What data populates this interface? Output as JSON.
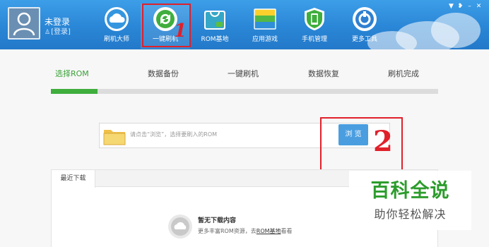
{
  "header": {
    "user": {
      "status": "未登录",
      "login_link": "[登录]"
    },
    "nav_tabs": [
      {
        "label": "刷机大师",
        "icon": "cloud-icon"
      },
      {
        "label": "一键刷机",
        "icon": "refresh-icon",
        "active": true
      },
      {
        "label": "ROM基地",
        "icon": "rom-bag-icon"
      },
      {
        "label": "应用游戏",
        "icon": "app-stack-icon"
      },
      {
        "label": "手机管理",
        "icon": "phone-shield-icon"
      },
      {
        "label": "更多工具",
        "icon": "tools-icon"
      }
    ],
    "window_controls": [
      "menu-icon",
      "skin-icon",
      "minimize-icon",
      "close-icon"
    ]
  },
  "annotations": {
    "mark1": "1",
    "mark2": "2"
  },
  "steps": {
    "items": [
      "选择ROM",
      "数据备份",
      "一键刷机",
      "数据恢复",
      "刷机完成"
    ],
    "active_index": 0,
    "progress_fraction": 0.12
  },
  "rom_select": {
    "placeholder": "请点击“浏览”，选择要刷入的ROM",
    "browse_label": "浏 览"
  },
  "downloads": {
    "tab_label": "最近下载",
    "empty_title": "暂无下载内容",
    "empty_desc_prefix": "更多丰富ROM资源，去",
    "empty_desc_link": "ROM基地",
    "empty_desc_suffix": "看看"
  },
  "watermark": {
    "title": "百科全说",
    "subtitle": "助你轻松解决"
  },
  "colors": {
    "header_blue": "#2a86d6",
    "step_active_green": "#3aa038",
    "progress_green": "#3fae3d",
    "browse_blue": "#4a9ee0",
    "annotation_red": "#e0202a",
    "watermark_green": "#2c9c2c"
  }
}
